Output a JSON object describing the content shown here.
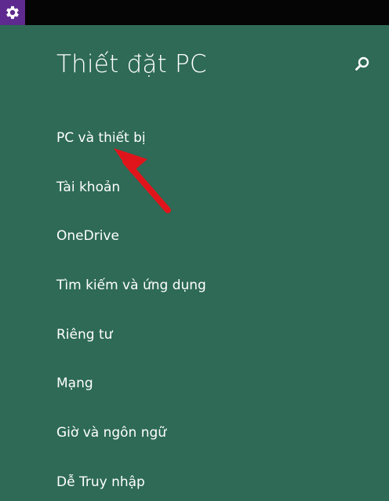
{
  "header": {
    "title": "Thiết đặt PC",
    "app_icon": "gear-icon",
    "search_icon": "search-icon"
  },
  "menu": {
    "items": [
      {
        "label": "PC và thiết bị"
      },
      {
        "label": "Tài khoản"
      },
      {
        "label": "OneDrive"
      },
      {
        "label": "Tìm kiếm và ứng dụng"
      },
      {
        "label": "Riêng tư"
      },
      {
        "label": "Mạng"
      },
      {
        "label": "Giờ và ngôn ngữ"
      },
      {
        "label": "Dễ Truy nhập"
      }
    ]
  },
  "annotation": {
    "arrow_color": "#e0151b"
  },
  "colors": {
    "background": "#2e6a56",
    "titlebar": "#050505",
    "app_icon_bg": "#5e2a8f"
  }
}
